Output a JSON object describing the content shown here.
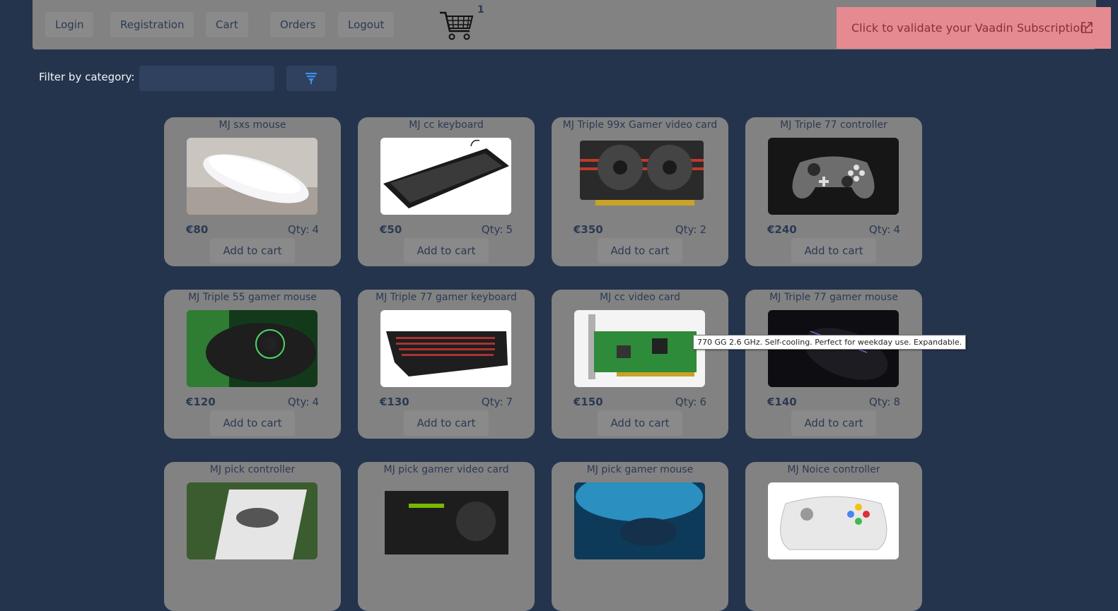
{
  "nav": {
    "items": [
      "Login",
      "Registration",
      "Cart",
      "Orders",
      "Logout"
    ],
    "cart_count": "1"
  },
  "notice": {
    "text": "Click to validate your Vaadin Subscription"
  },
  "filter": {
    "label": "Filter by category:",
    "value": ""
  },
  "products": [
    {
      "name": "MJ sxs mouse",
      "price": "€80",
      "qty_label": "Qty:",
      "qty": "4",
      "add": "Add to cart"
    },
    {
      "name": "MJ cc keyboard",
      "price": "€50",
      "qty_label": "Qty:",
      "qty": "5",
      "add": "Add to cart"
    },
    {
      "name": "MJ Triple 99x Gamer video card",
      "price": "€350",
      "qty_label": "Qty:",
      "qty": "2",
      "add": "Add to cart"
    },
    {
      "name": "MJ Triple 77 controller",
      "price": "€240",
      "qty_label": "Qty:",
      "qty": "4",
      "add": "Add to cart"
    },
    {
      "name": "MJ Triple 55 gamer mouse",
      "price": "€120",
      "qty_label": "Qty:",
      "qty": "4",
      "add": "Add to cart"
    },
    {
      "name": "MJ Triple 77 gamer keyboard",
      "price": "€130",
      "qty_label": "Qty:",
      "qty": "7",
      "add": "Add to cart"
    },
    {
      "name": "MJ cc video card",
      "price": "€150",
      "qty_label": "Qty:",
      "qty": "6",
      "add": "Add to cart"
    },
    {
      "name": "MJ Triple 77 gamer mouse",
      "price": "€140",
      "qty_label": "Qty:",
      "qty": "8",
      "add": "Add to cart"
    },
    {
      "name": "MJ pick controller"
    },
    {
      "name": "MJ pick gamer video card"
    },
    {
      "name": "MJ pick gamer mouse"
    },
    {
      "name": "MJ Noice controller"
    }
  ],
  "tooltip": {
    "text": "770 GG 2.6 GHz. Self-cooling. Perfect for weekday use. Expandable."
  }
}
